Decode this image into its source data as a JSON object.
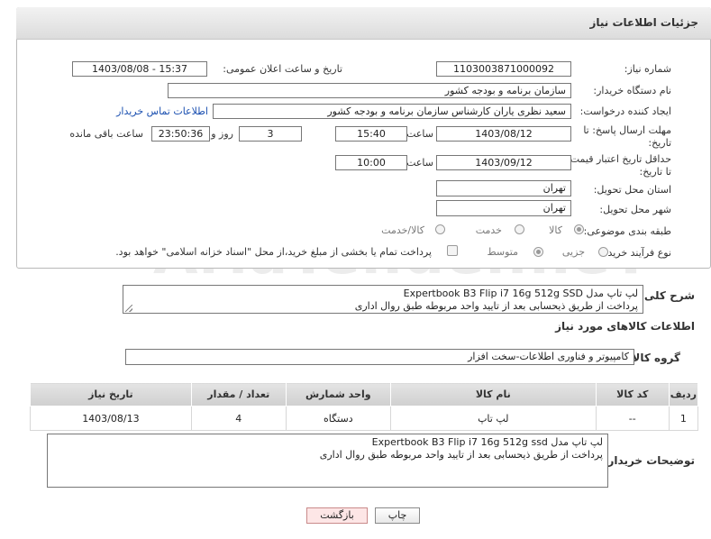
{
  "panel": {
    "title": "جزئیات اطلاعات نیاز"
  },
  "fields": {
    "need_number": {
      "label": "شماره نیاز:",
      "value": "1103003871000092"
    },
    "announce": {
      "label": "تاریخ و ساعت اعلان عمومی:",
      "value": "1403/08/08 - 15:37"
    },
    "buyer_org": {
      "label": "نام دستگاه خریدار:",
      "value": "سازمان برنامه و بودجه کشور"
    },
    "requester": {
      "label": "ایجاد کننده درخواست:",
      "value": "سعید نظری یاران کارشناس سازمان برنامه و بودجه کشور",
      "link": "اطلاعات تماس خریدار"
    },
    "deadline": {
      "label": "مهلت ارسال پاسخ: تا تاریخ:",
      "date": "1403/08/12",
      "time_label": "ساعت",
      "time": "15:40",
      "days": "3",
      "days_label": "روز و",
      "remaining": "23:50:36",
      "remaining_label": "ساعت باقی مانده"
    },
    "validity": {
      "label": "حداقل تاریخ اعتبار قیمت: تا تاریخ:",
      "date": "1403/09/12",
      "time_label": "ساعت",
      "time": "10:00"
    },
    "province": {
      "label": "استان محل تحویل:",
      "value": "تهران"
    },
    "city": {
      "label": "شهر محل تحویل:",
      "value": "تهران"
    },
    "category": {
      "label": "طبقه بندی موضوعی:",
      "options": [
        "کالا",
        "خدمت",
        "کالا/خدمت"
      ],
      "selected": "کالا"
    },
    "process": {
      "label": "نوع فرآیند خرید :",
      "options": [
        "جزیی",
        "متوسط"
      ],
      "note": "پرداخت تمام یا بخشی از مبلغ خرید،از محل \"اسناد خزانه اسلامی\" خواهد بود."
    }
  },
  "summary": {
    "label": "شرح کلی نیاز:",
    "line1": "لپ تاپ مدل Expertbook B3 Flip i7 16g 512g SSD",
    "line2": "پرداخت از طریق ذیحسابی بعد از تایید واحد مربوطه طبق روال اداری"
  },
  "goods_info": {
    "title": "اطلاعات کالاهای مورد نیاز"
  },
  "goods_group": {
    "label": "گروه کالا:",
    "value": "کامپیوتر و فناوری اطلاعات-سخت افزار"
  },
  "table": {
    "headers": [
      "ردیف",
      "کد کالا",
      "نام کالا",
      "واحد شمارش",
      "تعداد / مقدار",
      "تاریخ نیاز"
    ],
    "rows": [
      [
        "1",
        "--",
        "لپ تاپ",
        "دستگاه",
        "4",
        "1403/08/13"
      ]
    ]
  },
  "buyer_notes": {
    "label": "توضیحات خریدار:",
    "line1": "لپ تاپ مدل Expertbook B3 Flip i7 16g 512g ssd",
    "line2": "پرداخت از طریق ذیحسابی بعد از تایید واحد مربوطه طبق روال اداری"
  },
  "buttons": {
    "print": "چاپ",
    "back": "بازگشت"
  },
  "watermark": "AriaTender.neT"
}
